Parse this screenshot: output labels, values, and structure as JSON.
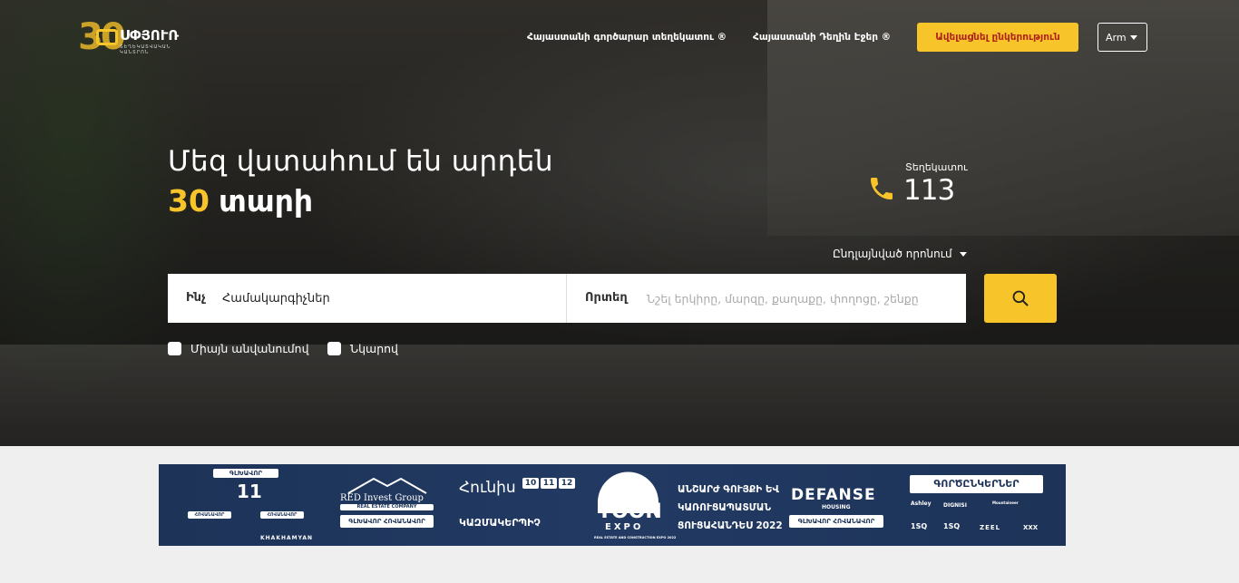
{
  "header": {
    "logo": {
      "number": "30",
      "brand": "ՍՓՅՈՒՌ",
      "tagline": "ՏԵՂԵԿԱՏՎԱԿԱՆ ԿԱՆՏՐՈՆ"
    },
    "nav": [
      {
        "label": "Հայաստանի գործարար տեղեկատու ®"
      },
      {
        "label": "Հայաստանի Դեղին Էջեր ®"
      }
    ],
    "add_company_label": "Ավելացնել ընկերություն",
    "language": "Arm"
  },
  "hero": {
    "line1": "Մեզ վստահում են արդեն",
    "years": "30",
    "years_word": "տարի",
    "phone_label": "Տեղեկատու",
    "phone_number": "113",
    "phone_icon": "phone-icon",
    "advanced_search_label": "Ընդլայնված որոնում"
  },
  "search": {
    "what_label": "Ինչ",
    "what_value": "Համակարգիչներ",
    "where_label": "Որտեղ",
    "where_placeholder": "Նշել երկիրը, մարզը, քաղաքը, փողոցը, շենքը",
    "button_icon": "search-icon",
    "filters": [
      {
        "label": "Միայն անվանումով",
        "checked": false
      },
      {
        "label": "Նկարով",
        "checked": false
      }
    ]
  },
  "banner": {
    "sponsors_title": "ԳԼԽԱՎՈՐ ԳՈՐԾԸՆԿԵՐ",
    "sponsor_sub1": "ՀՈՎԱՆԱՎՈՐ",
    "sponsor_sub2": "ՀՈՎԱՆԱՎՈՐ",
    "sponsor_brand": "KHAKHAMYAN",
    "red_invest": "RED Invest Group",
    "red_invest_sub": "REAL ESTATE COMPANY",
    "general_sponsor": "ԳԼԽԱՎՈՐ ՀՈՎԱՆԱՎՈՐ",
    "month": "Հունիս",
    "days": [
      "10",
      "11",
      "12"
    ],
    "organizer": "ԿԱԶՄԱԿԵՐՊԻՉ",
    "toon": "TOON",
    "expo": "EXPO",
    "expo_sub": "REAL ESTATE AND CONSTRUCTION EXPO 2022",
    "exhibition_lines": [
      "ԱՆՇԱՐԺ ԳՈՒՅՔԻ ԵՎ",
      "ԿԱՌՈՒՑԱՊԱՏՄԱՆ",
      "ՑՈՒՑԱՀԱՆԴԵՍ 2022"
    ],
    "defanse": "DEFANSE",
    "defanse_sub": "HOUSING",
    "defanse_sponsor": "ԳԼԽԱՎՈՐ ՀՈՎԱՆԱՎՈՐ",
    "partners_title": "ԳՈՐԾԸՆԿԵՐՆԵՐ",
    "partners": [
      "Ashley",
      "DIGNISI",
      "Mountaineer",
      "1SQ",
      "1SQ",
      "ZEEL",
      "XXX"
    ]
  },
  "colors": {
    "accent": "#f7c52a",
    "accent_text": "#b0231b",
    "banner_bg": "#1d3358"
  }
}
